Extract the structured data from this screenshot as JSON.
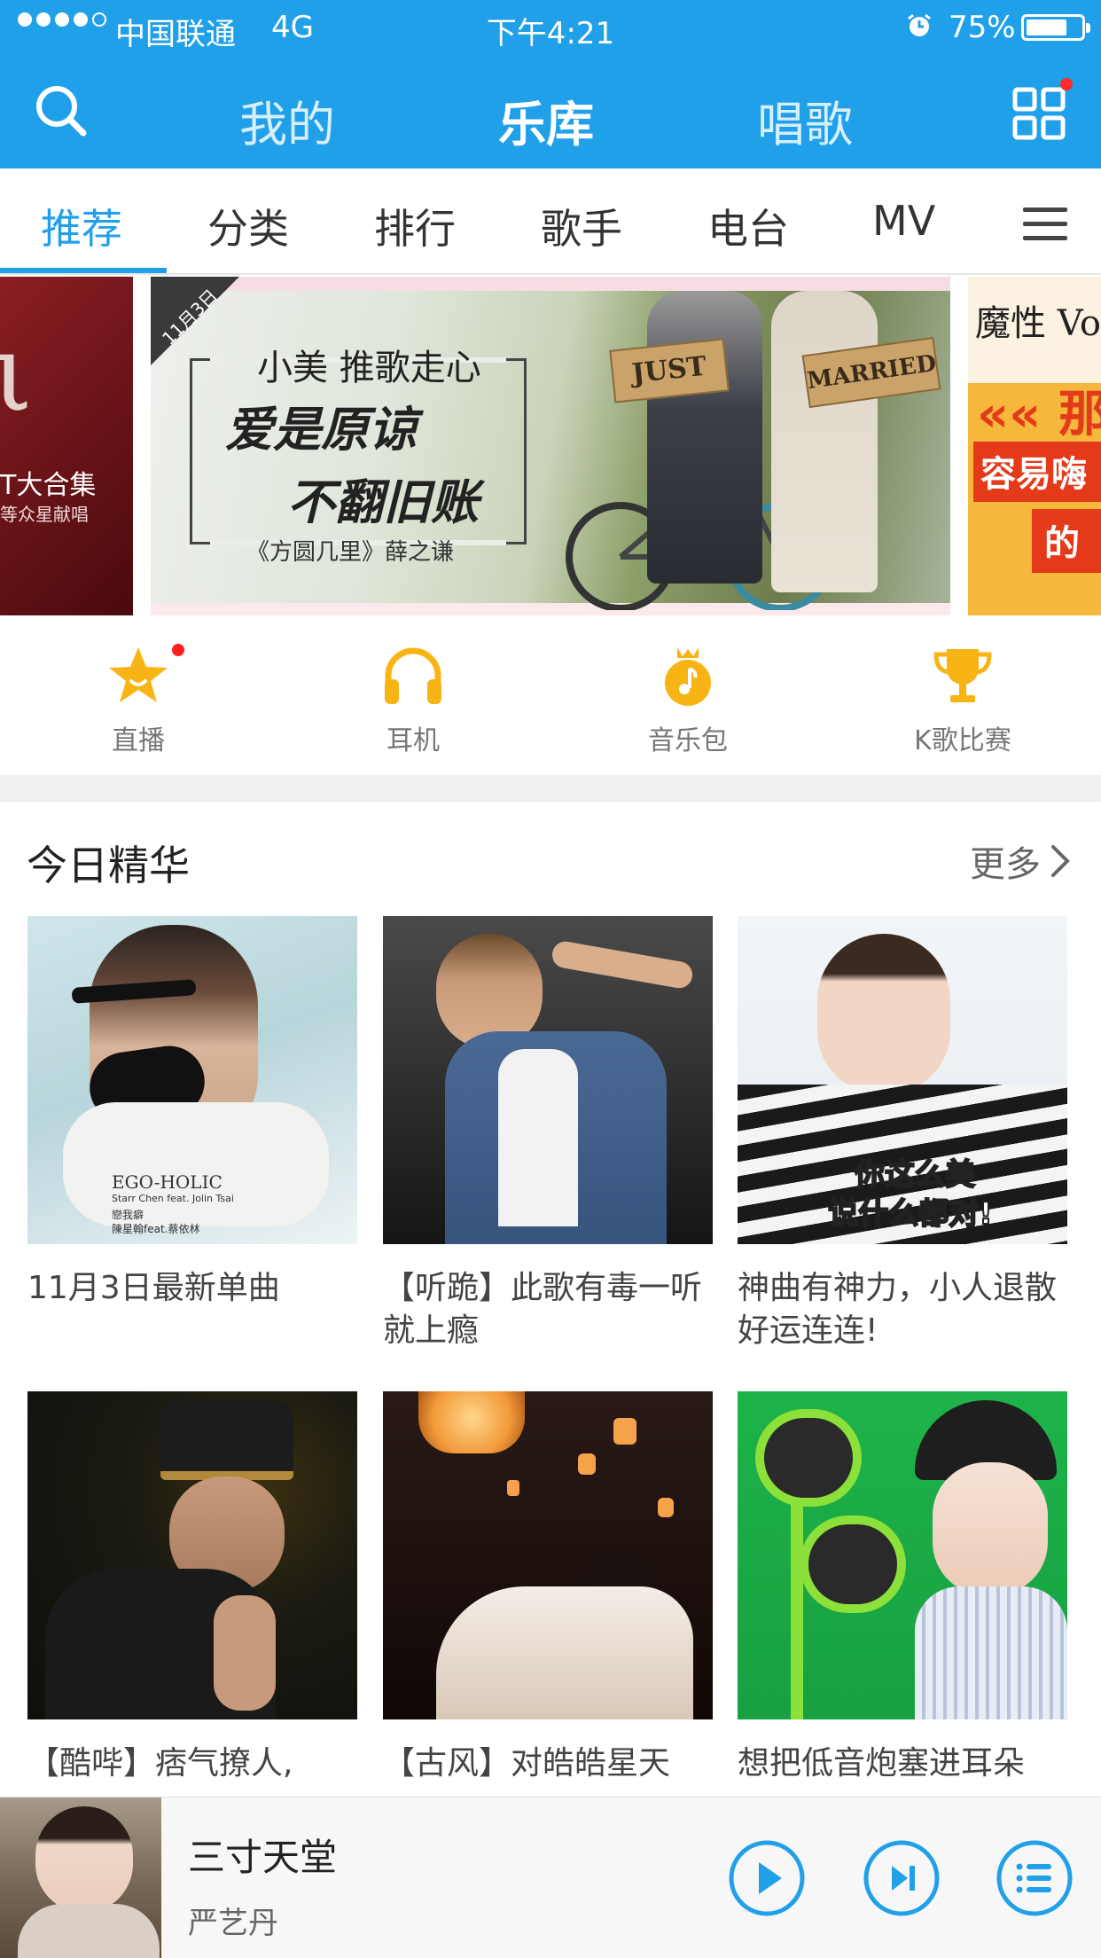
{
  "status_bar": {
    "carrier": "中国联通",
    "network": "4G",
    "time": "下午4:21",
    "battery": "75%",
    "battery_level": 0.75
  },
  "nav": {
    "tabs": [
      "我的",
      "乐库",
      "唱歌"
    ],
    "active": "乐库"
  },
  "categories": {
    "items": [
      "推荐",
      "分类",
      "排行",
      "歌手",
      "电台",
      "MV"
    ],
    "active": "推荐"
  },
  "banner": {
    "left": {
      "title": "T大合集",
      "subtitle": "等众星献唱"
    },
    "main": {
      "ribbon": "11月3日",
      "line1": "小美 推歌走心",
      "line2": "爱是原谅",
      "line3": "不翻旧账",
      "line4": "《方圆几里》薛之谦",
      "sign1": "JUST",
      "sign2": "MARRIED"
    },
    "right": {
      "line1": "魔性 Vol.",
      "line2": "«« 那",
      "line3": "容易嗨",
      "line4": "的"
    }
  },
  "quick_entries": [
    {
      "label": "直播",
      "icon": "star-icon"
    },
    {
      "label": "耳机",
      "icon": "headphones-icon"
    },
    {
      "label": "音乐包",
      "icon": "music-bag-icon"
    },
    {
      "label": "K歌比赛",
      "icon": "trophy-icon"
    }
  ],
  "section": {
    "title": "今日精华",
    "more": "更多"
  },
  "cards": [
    {
      "caption": "11月3日最新单曲",
      "cover_title": "EGO-HOLIC",
      "cover_sub1": "Starr Chen feat. Jolin Tsai",
      "cover_sub2": "戀我癖",
      "cover_sub3": "陳星翰feat.蔡依林"
    },
    {
      "caption": "【听跪】此歌有毒一听就上瘾"
    },
    {
      "caption": "神曲有神力，小人退散好运连连!",
      "cover_text1": "你这么美",
      "cover_text2": "说什么都对!"
    },
    {
      "caption": "【酷哔】痞气撩人,"
    },
    {
      "caption": "【古风】对皓皓星天"
    },
    {
      "caption": "想把低音炮塞进耳朵"
    }
  ],
  "player": {
    "title": "三寸天堂",
    "artist": "严艺丹"
  },
  "colors": {
    "accent": "#21a0ea",
    "icon_yellow": "#f8b415",
    "badge_red": "#ff1e1e"
  }
}
